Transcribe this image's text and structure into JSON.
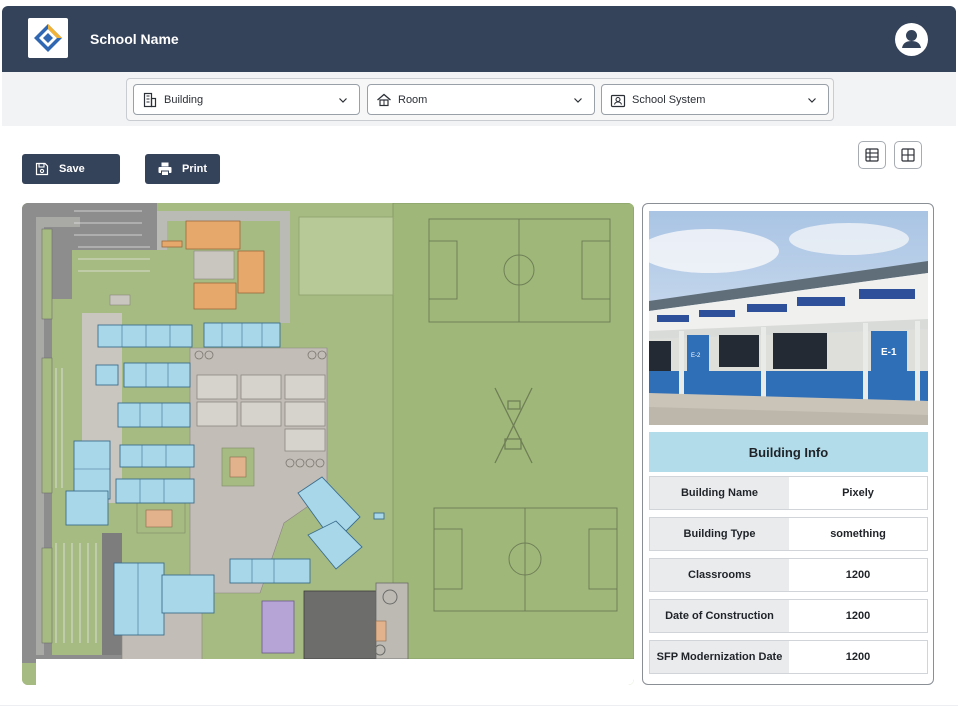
{
  "header": {
    "title": "School Name"
  },
  "filters": [
    {
      "label": "Building",
      "icon": "building-icon"
    },
    {
      "label": "Room",
      "icon": "room-icon"
    },
    {
      "label": "School System",
      "icon": "school-system-icon"
    }
  ],
  "toolbar": {
    "save_label": "Save",
    "print_label": "Print"
  },
  "info": {
    "title": "Building Info",
    "rows": [
      {
        "label": "Building Name",
        "value": "Pixely"
      },
      {
        "label": "Building Type",
        "value": "something"
      },
      {
        "label": "Classrooms",
        "value": "1200"
      },
      {
        "label": "Date of Construction",
        "value": "1200"
      },
      {
        "label": "SFP Modernization Date",
        "value": "1200"
      }
    ],
    "photo_signs": [
      "E-1",
      "E-2"
    ]
  },
  "colors": {
    "header_bg": "#34425a",
    "info_header_bg": "#b3dcea",
    "map_grass": "#a6bb81",
    "building_blue": "#a8d7ea",
    "building_orange": "#e7a86b"
  }
}
